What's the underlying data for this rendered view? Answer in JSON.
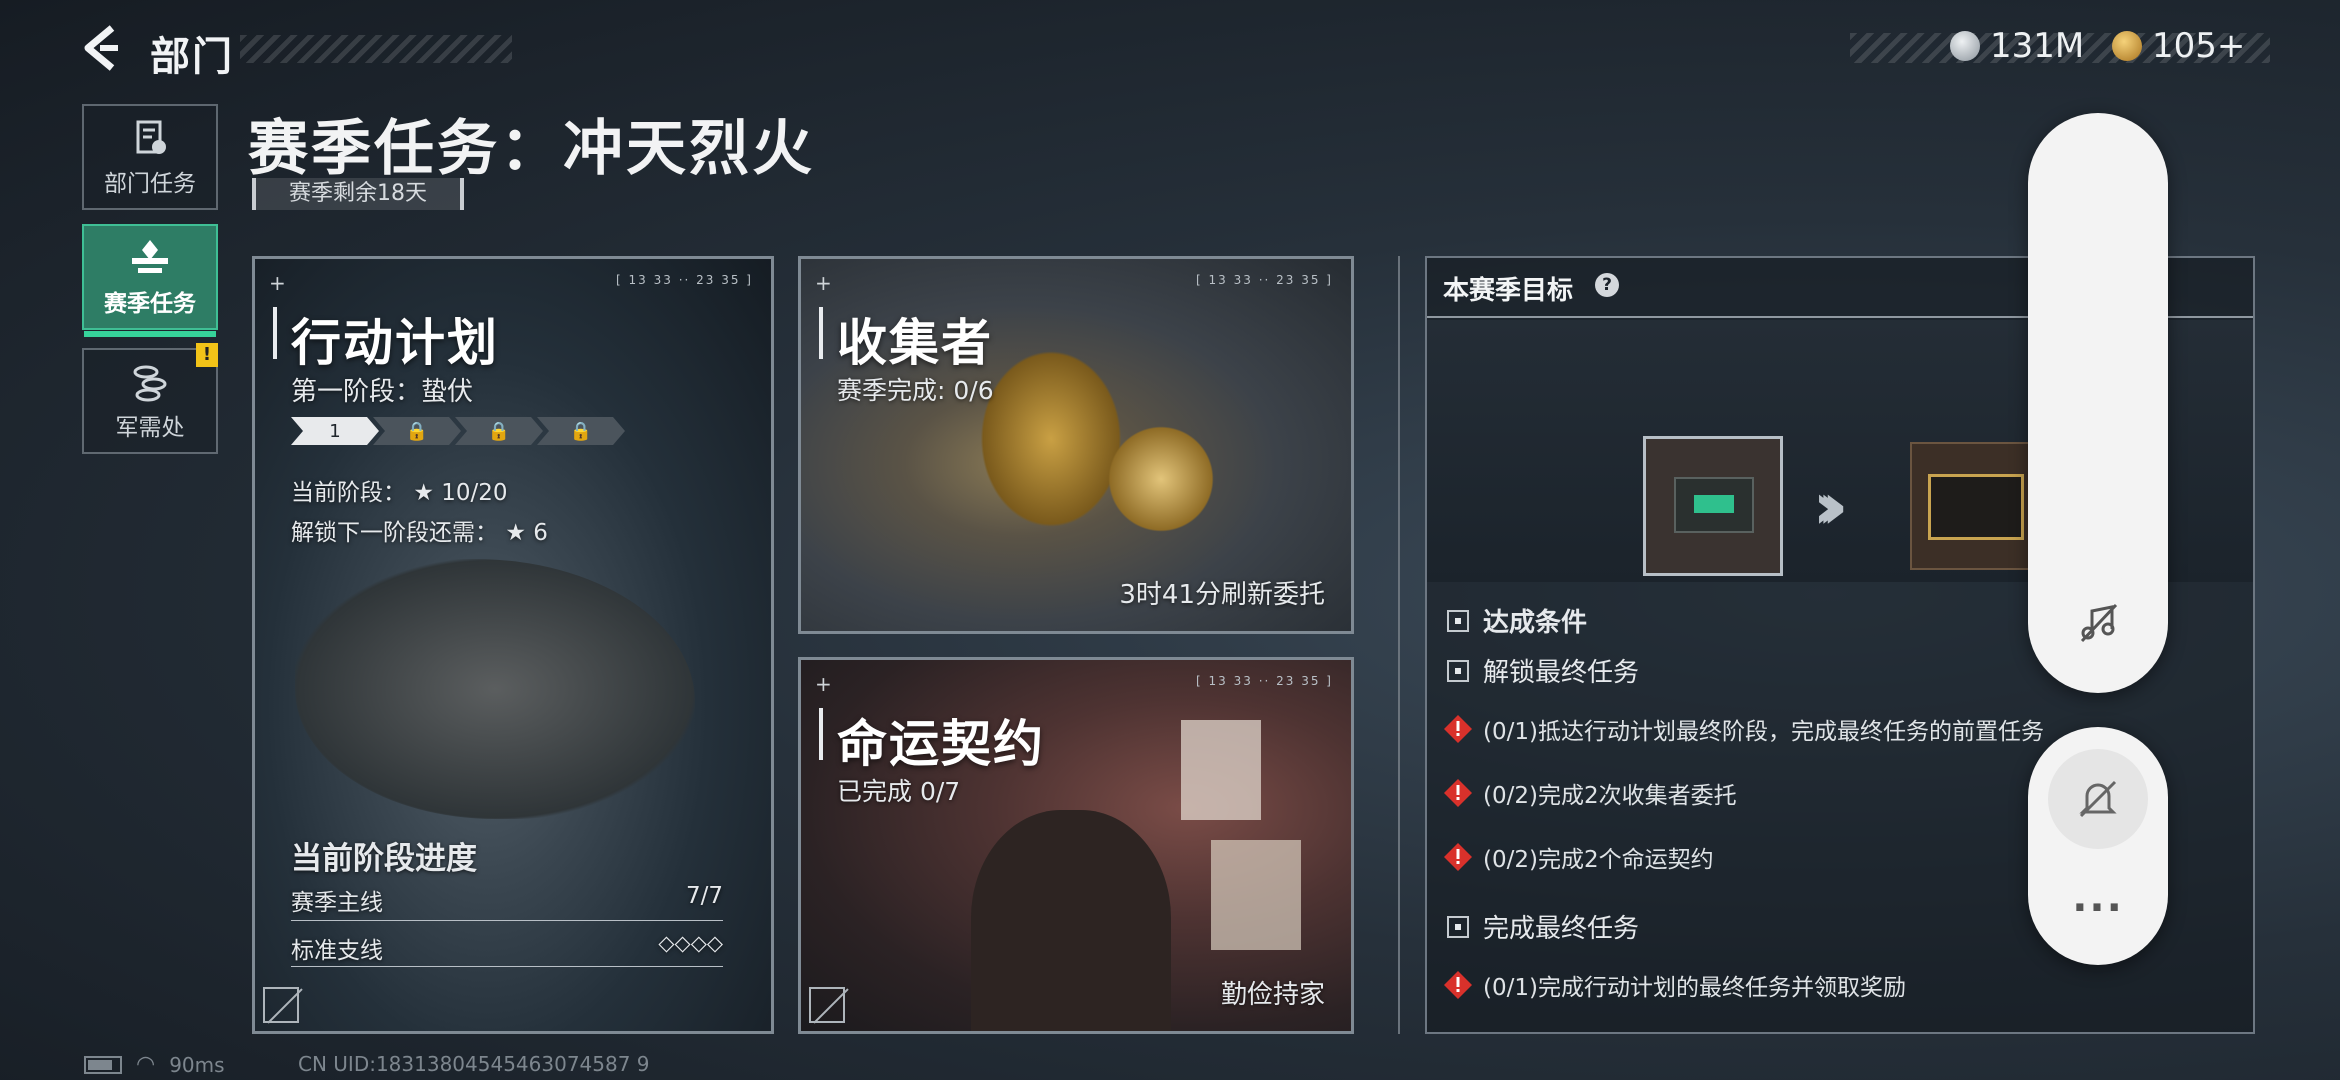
{
  "header": {
    "back_icon": "back-arrow-icon",
    "title": "部门"
  },
  "currency": [
    {
      "icon": "silver-coin-icon",
      "value": "131M",
      "color": "#b8bfc6"
    },
    {
      "icon": "gold-coin-icon",
      "value": "105+",
      "color": "#d6a13b"
    }
  ],
  "sidebar": {
    "items": [
      {
        "label": "部门任务",
        "icon": "task-list-icon",
        "active": false
      },
      {
        "label": "赛季任务",
        "icon": "season-emblem-icon",
        "active": true
      },
      {
        "label": "军需处",
        "icon": "coin-stack-icon",
        "active": false,
        "badge": "!"
      }
    ]
  },
  "page": {
    "title": "赛季任务：冲天烈火",
    "season_remaining": "赛季剩余18天"
  },
  "cards": {
    "operation": {
      "title": "行动计划",
      "stage_name": "第一阶段：蛰伏",
      "stages": [
        {
          "label": "1",
          "locked": false
        },
        {
          "label": "",
          "locked": true
        },
        {
          "label": "",
          "locked": true
        },
        {
          "label": "",
          "locked": true
        }
      ],
      "current_stage_label": "当前阶段：",
      "current_stage_value": "10/20",
      "unlock_label": "解锁下一阶段还需：",
      "unlock_value": "6",
      "progress_heading": "当前阶段进度",
      "main_line_label": "赛季主线",
      "main_line_value": "7/7",
      "branch_label": "标准支线",
      "branch_value": "◇◇◇◇",
      "timecode": "[ 13 33 ·· 23 35 ]"
    },
    "collector": {
      "title": "收集者",
      "progress": "赛季完成: 0/6",
      "refresh": "3时41分刷新委托",
      "timecode": "[ 13 33 ·· 23 35 ]"
    },
    "fate": {
      "title": "命运契约",
      "progress": "已完成 0/7",
      "caption": "勤俭持家",
      "timecode": "[ 13 33 ·· 23 35 ]"
    }
  },
  "objective": {
    "heading": "本赛季目标",
    "help": "?",
    "conditions_heading": "达成条件",
    "groups": [
      {
        "title": "解锁最终任务",
        "items": [
          "(0/1)抵达行动计划最终阶段，完成最终任务的前置任务",
          "(0/2)完成2次收集者委托",
          "(0/2)完成2个命运契约"
        ]
      },
      {
        "title": "完成最终任务",
        "items": [
          "(0/1)完成行动计划的最终任务并领取奖励"
        ]
      }
    ]
  },
  "overlay": {
    "top_icon": "music-off-icon",
    "bell_icon": "bell-off-icon",
    "more_label": "···"
  },
  "status": {
    "ping": "90ms",
    "uid": "CN UID:18313804545463074587 9"
  },
  "colors": {
    "accent_green": "#2e7d65",
    "warning_red": "#d9312b",
    "badge_yellow": "#f2c318"
  }
}
